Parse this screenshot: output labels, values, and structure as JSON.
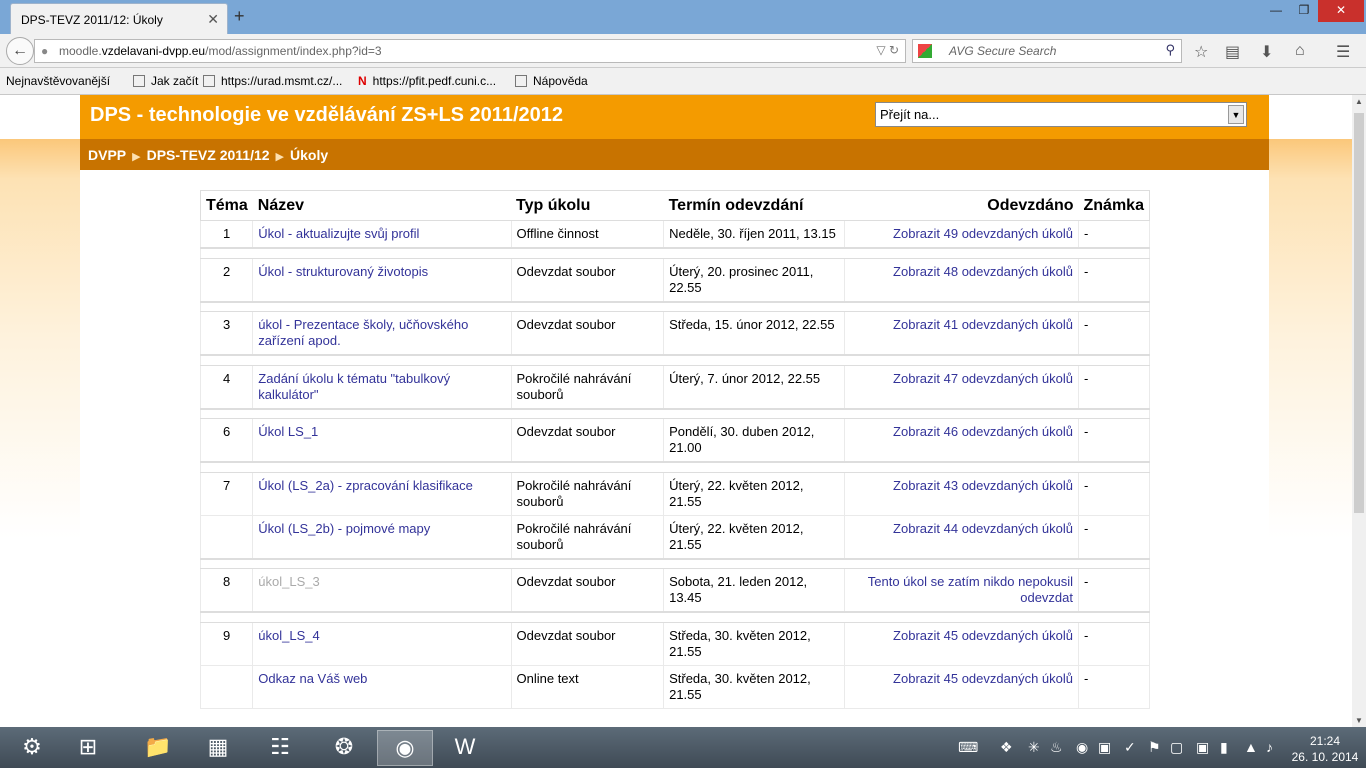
{
  "browser": {
    "tab_title": "DPS-TEVZ 2011/12: Úkoly",
    "tab_close": "✕",
    "new_tab": "+",
    "url_prefix": "moodle.",
    "url_domain": "vzdelavani-dvpp.eu",
    "url_path": "/mod/assignment/index.php?id=3",
    "search_placeholder": "AVG Secure Search",
    "bookmarks": [
      {
        "label": "Nejnavštěvovanější"
      },
      {
        "label": "Jak začít"
      },
      {
        "label": "https://urad.msmt.cz/..."
      },
      {
        "label": "https://pfit.pedf.cuni.c..."
      },
      {
        "label": "Nápověda"
      }
    ]
  },
  "header": {
    "site_title": "DPS - technologie ve vzdělávání ZS+LS 2011/2012",
    "jump_label": "Přejít na..."
  },
  "breadcrumb": [
    "DVPP",
    "DPS-TEVZ 2011/12",
    "Úkoly"
  ],
  "table": {
    "headers": {
      "topic": "Téma",
      "name": "Název",
      "type": "Typ úkolu",
      "due": "Termín odevzdání",
      "submitted": "Odevzdáno",
      "grade": "Známka"
    },
    "groups": [
      {
        "topic": "1",
        "rows": [
          {
            "name": "Úkol - aktualizujte svůj profil",
            "type": "Offline činnost",
            "due": "Neděle, 30. říjen 2011, 13.15",
            "submitted": "Zobrazit 49 odevzdaných úkolů",
            "grade": "-"
          }
        ]
      },
      {
        "topic": "2",
        "rows": [
          {
            "name": "Úkol - strukturovaný životopis",
            "type": "Odevzdat soubor",
            "due": "Úterý, 20. prosinec 2011, 22.55",
            "submitted": "Zobrazit 48 odevzdaných úkolů",
            "grade": "-"
          }
        ]
      },
      {
        "topic": "3",
        "rows": [
          {
            "name": "úkol - Prezentace školy, učňovského zařízení apod.",
            "type": "Odevzdat soubor",
            "due": "Středa, 15. únor 2012, 22.55",
            "submitted": "Zobrazit 41 odevzdaných úkolů",
            "grade": "-"
          }
        ]
      },
      {
        "topic": "4",
        "rows": [
          {
            "name": "Zadání úkolu k tématu \"tabulkový kalkulátor\"",
            "type": "Pokročilé nahrávání souborů",
            "due": "Úterý, 7. únor 2012, 22.55",
            "submitted": "Zobrazit 47 odevzdaných úkolů",
            "grade": "-"
          }
        ]
      },
      {
        "topic": "6",
        "rows": [
          {
            "name": "Úkol LS_1",
            "type": "Odevzdat soubor",
            "due": "Pondělí, 30. duben 2012, 21.00",
            "submitted": "Zobrazit 46 odevzdaných úkolů",
            "grade": "-"
          }
        ]
      },
      {
        "topic": "7",
        "rows": [
          {
            "name": "Úkol (LS_2a) - zpracování klasifikace",
            "type": "Pokročilé nahrávání souborů",
            "due": "Úterý, 22. květen 2012, 21.55",
            "submitted": "Zobrazit 43 odevzdaných úkolů",
            "grade": "-"
          },
          {
            "name": "Úkol (LS_2b) - pojmové mapy",
            "type": "Pokročilé nahrávání souborů",
            "due": "Úterý, 22. květen 2012, 21.55",
            "submitted": "Zobrazit 44 odevzdaných úkolů",
            "grade": "-"
          }
        ]
      },
      {
        "topic": "8",
        "rows": [
          {
            "name": "úkol_LS_3",
            "type": "Odevzdat soubor",
            "due": "Sobota, 21. leden 2012, 13.45",
            "submitted": "Tento úkol se zatím nikdo nepokusil odevzdat",
            "grade": "-"
          }
        ]
      },
      {
        "topic": "9",
        "rows": [
          {
            "name": "úkol_LS_4",
            "type": "Odevzdat soubor",
            "due": "Středa, 30. květen 2012, 21.55",
            "submitted": "Zobrazit 45 odevzdaných úkolů",
            "grade": "-"
          },
          {
            "name": "Odkaz na Váš web",
            "type": "Online text",
            "due": "Středa, 30. květen 2012, 21.55",
            "submitted": "Zobrazit 45 odevzdaných úkolů",
            "grade": "-"
          }
        ]
      }
    ]
  },
  "taskbar": {
    "time": "21:24",
    "date": "26. 10. 2014"
  },
  "colors": {
    "header": "#f49b00",
    "breadcrumb_bar": "#c87300",
    "link": "#333399",
    "dimmed_link": "#aaaaaa"
  }
}
